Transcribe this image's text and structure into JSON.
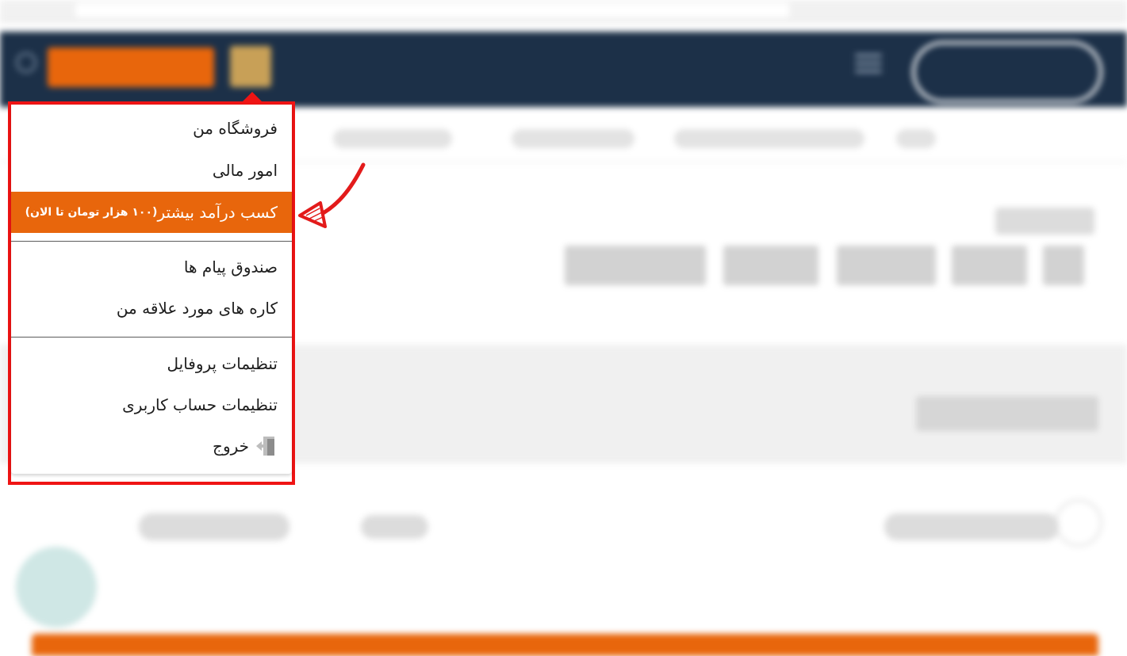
{
  "menu": {
    "items": [
      {
        "label": "فروشگاه من"
      },
      {
        "label": "امور مالی"
      },
      {
        "label": "کسب درآمد بیشتر",
        "suffix": "(۱۰۰ هزار تومان تا الان)"
      },
      {
        "label": "صندوق پیام ها"
      },
      {
        "label": "کاره های مورد علاقه من"
      },
      {
        "label": "تنظیمات پروفایل"
      },
      {
        "label": "تنظیمات حساب کاربری"
      },
      {
        "label": "خروج",
        "icon": "exit-icon"
      }
    ]
  },
  "colors": {
    "header": "#1c3048",
    "accent": "#e8660c",
    "highlight_frame": "#ef1414"
  }
}
